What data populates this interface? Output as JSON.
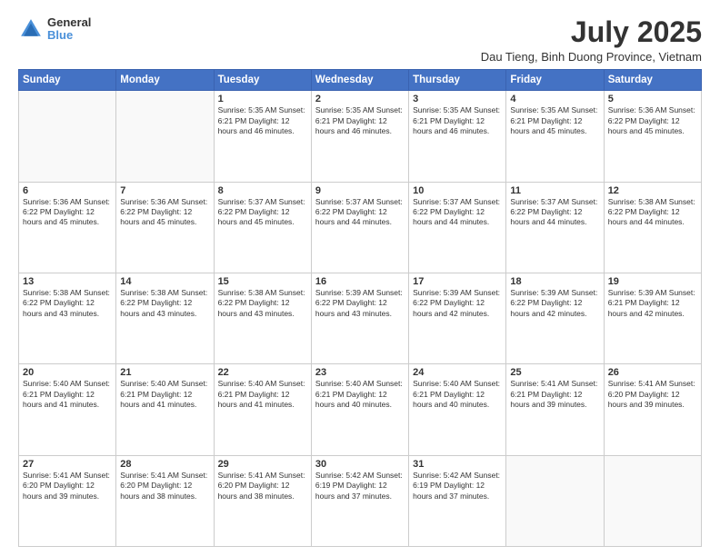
{
  "logo": {
    "line1": "General",
    "line2": "Blue"
  },
  "title": "July 2025",
  "subtitle": "Dau Tieng, Binh Duong Province, Vietnam",
  "weekdays": [
    "Sunday",
    "Monday",
    "Tuesday",
    "Wednesday",
    "Thursday",
    "Friday",
    "Saturday"
  ],
  "weeks": [
    [
      {
        "day": "",
        "info": ""
      },
      {
        "day": "",
        "info": ""
      },
      {
        "day": "1",
        "info": "Sunrise: 5:35 AM\nSunset: 6:21 PM\nDaylight: 12 hours and 46 minutes."
      },
      {
        "day": "2",
        "info": "Sunrise: 5:35 AM\nSunset: 6:21 PM\nDaylight: 12 hours and 46 minutes."
      },
      {
        "day": "3",
        "info": "Sunrise: 5:35 AM\nSunset: 6:21 PM\nDaylight: 12 hours and 46 minutes."
      },
      {
        "day": "4",
        "info": "Sunrise: 5:35 AM\nSunset: 6:21 PM\nDaylight: 12 hours and 45 minutes."
      },
      {
        "day": "5",
        "info": "Sunrise: 5:36 AM\nSunset: 6:22 PM\nDaylight: 12 hours and 45 minutes."
      }
    ],
    [
      {
        "day": "6",
        "info": "Sunrise: 5:36 AM\nSunset: 6:22 PM\nDaylight: 12 hours and 45 minutes."
      },
      {
        "day": "7",
        "info": "Sunrise: 5:36 AM\nSunset: 6:22 PM\nDaylight: 12 hours and 45 minutes."
      },
      {
        "day": "8",
        "info": "Sunrise: 5:37 AM\nSunset: 6:22 PM\nDaylight: 12 hours and 45 minutes."
      },
      {
        "day": "9",
        "info": "Sunrise: 5:37 AM\nSunset: 6:22 PM\nDaylight: 12 hours and 44 minutes."
      },
      {
        "day": "10",
        "info": "Sunrise: 5:37 AM\nSunset: 6:22 PM\nDaylight: 12 hours and 44 minutes."
      },
      {
        "day": "11",
        "info": "Sunrise: 5:37 AM\nSunset: 6:22 PM\nDaylight: 12 hours and 44 minutes."
      },
      {
        "day": "12",
        "info": "Sunrise: 5:38 AM\nSunset: 6:22 PM\nDaylight: 12 hours and 44 minutes."
      }
    ],
    [
      {
        "day": "13",
        "info": "Sunrise: 5:38 AM\nSunset: 6:22 PM\nDaylight: 12 hours and 43 minutes."
      },
      {
        "day": "14",
        "info": "Sunrise: 5:38 AM\nSunset: 6:22 PM\nDaylight: 12 hours and 43 minutes."
      },
      {
        "day": "15",
        "info": "Sunrise: 5:38 AM\nSunset: 6:22 PM\nDaylight: 12 hours and 43 minutes."
      },
      {
        "day": "16",
        "info": "Sunrise: 5:39 AM\nSunset: 6:22 PM\nDaylight: 12 hours and 43 minutes."
      },
      {
        "day": "17",
        "info": "Sunrise: 5:39 AM\nSunset: 6:22 PM\nDaylight: 12 hours and 42 minutes."
      },
      {
        "day": "18",
        "info": "Sunrise: 5:39 AM\nSunset: 6:22 PM\nDaylight: 12 hours and 42 minutes."
      },
      {
        "day": "19",
        "info": "Sunrise: 5:39 AM\nSunset: 6:21 PM\nDaylight: 12 hours and 42 minutes."
      }
    ],
    [
      {
        "day": "20",
        "info": "Sunrise: 5:40 AM\nSunset: 6:21 PM\nDaylight: 12 hours and 41 minutes."
      },
      {
        "day": "21",
        "info": "Sunrise: 5:40 AM\nSunset: 6:21 PM\nDaylight: 12 hours and 41 minutes."
      },
      {
        "day": "22",
        "info": "Sunrise: 5:40 AM\nSunset: 6:21 PM\nDaylight: 12 hours and 41 minutes."
      },
      {
        "day": "23",
        "info": "Sunrise: 5:40 AM\nSunset: 6:21 PM\nDaylight: 12 hours and 40 minutes."
      },
      {
        "day": "24",
        "info": "Sunrise: 5:40 AM\nSunset: 6:21 PM\nDaylight: 12 hours and 40 minutes."
      },
      {
        "day": "25",
        "info": "Sunrise: 5:41 AM\nSunset: 6:21 PM\nDaylight: 12 hours and 39 minutes."
      },
      {
        "day": "26",
        "info": "Sunrise: 5:41 AM\nSunset: 6:20 PM\nDaylight: 12 hours and 39 minutes."
      }
    ],
    [
      {
        "day": "27",
        "info": "Sunrise: 5:41 AM\nSunset: 6:20 PM\nDaylight: 12 hours and 39 minutes."
      },
      {
        "day": "28",
        "info": "Sunrise: 5:41 AM\nSunset: 6:20 PM\nDaylight: 12 hours and 38 minutes."
      },
      {
        "day": "29",
        "info": "Sunrise: 5:41 AM\nSunset: 6:20 PM\nDaylight: 12 hours and 38 minutes."
      },
      {
        "day": "30",
        "info": "Sunrise: 5:42 AM\nSunset: 6:19 PM\nDaylight: 12 hours and 37 minutes."
      },
      {
        "day": "31",
        "info": "Sunrise: 5:42 AM\nSunset: 6:19 PM\nDaylight: 12 hours and 37 minutes."
      },
      {
        "day": "",
        "info": ""
      },
      {
        "day": "",
        "info": ""
      }
    ]
  ]
}
